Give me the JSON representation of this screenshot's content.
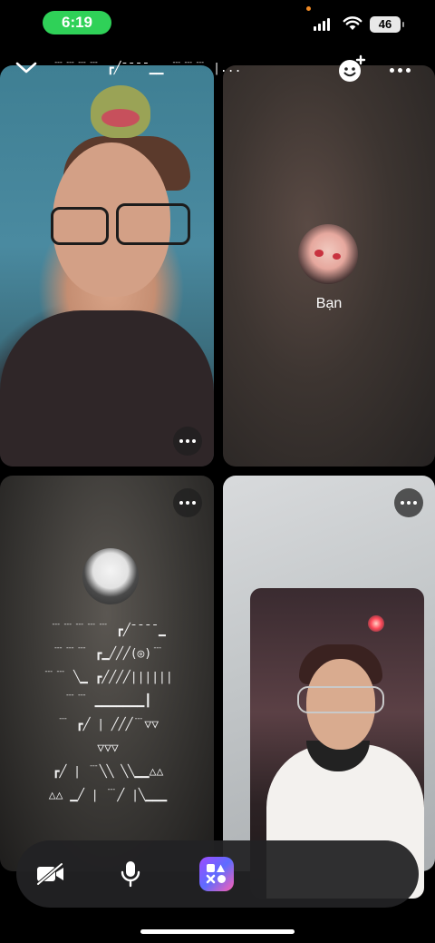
{
  "status_bar": {
    "time": "6:19",
    "battery": "46",
    "accent_color": "#2fd158"
  },
  "header": {
    "title": "﹉﹉﹉﹉ ┏╱¯¯¯¯▁▁ ﹉﹉﹉ |..."
  },
  "participants": [
    {
      "tile": "top-left",
      "type": "video"
    },
    {
      "tile": "top-right",
      "type": "avatar",
      "name": "Bạn"
    },
    {
      "tile": "bottom-left",
      "type": "avatar",
      "display_name_lines": [
        "﹉﹉﹉﹉﹉ ┏╱¯¯¯¯▁",
        "﹉﹉﹉ ┏▁╱╱╱(◎)﹉",
        "﹉﹉ ╲▁ ┏╱╱╱╱||||||",
        "﹉﹉ ▁▁▁▁▁▁▁┃",
        "﹉ ┏╱ | ╱╱╱﹉▽▽",
        "▽▽▽",
        "┏╱ | ﹉╲╲ ╲╲▁▁△△",
        "△△ ▁╱ | ﹉╱ |╲▁▁▁"
      ]
    },
    {
      "tile": "bottom-right",
      "type": "video"
    }
  ],
  "self_view": {
    "label": "self-view"
  },
  "controls": {
    "camera": "camera-off-icon",
    "microphone": "microphone-icon",
    "apps": "apps-icon"
  }
}
